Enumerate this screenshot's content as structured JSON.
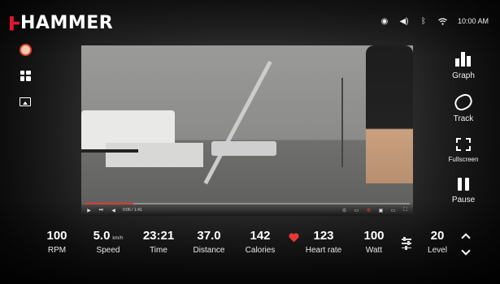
{
  "brand": {
    "name": "HAMMER",
    "accent": "#e0182d"
  },
  "status_bar": {
    "icons": [
      "nfc-icon",
      "volume-icon",
      "bluetooth-icon",
      "wifi-icon"
    ],
    "time": "10:00 AM"
  },
  "left_rail": {
    "items": [
      "profile-avatar",
      "grid-icon",
      "screen-cast-icon"
    ]
  },
  "video": {
    "time_label": "0:06 / 1:41",
    "progress_percent": 15,
    "controls": [
      "play-icon",
      "next-icon",
      "volume-icon",
      "settings-icon",
      "subtitles-icon",
      "miniplayer-icon",
      "theater-icon",
      "fullscreen-icon"
    ]
  },
  "right_rail": {
    "graph": "Graph",
    "track": "Track",
    "fullscreen": "Fullscreen",
    "pause": "Pause"
  },
  "metrics": {
    "rpm": {
      "value": "100",
      "label": "RPM"
    },
    "speed": {
      "value": "5.0",
      "unit": "km/h",
      "label": "Speed"
    },
    "time": {
      "value": "23:21",
      "label": "Time"
    },
    "distance": {
      "value": "37.0",
      "label": "Distance"
    },
    "calories": {
      "value": "142",
      "label": "Calories"
    },
    "heart_rate": {
      "value": "123",
      "label": "Heart rate"
    },
    "watt": {
      "value": "100",
      "label": "Watt"
    },
    "level": {
      "value": "20",
      "label": "Level"
    }
  }
}
